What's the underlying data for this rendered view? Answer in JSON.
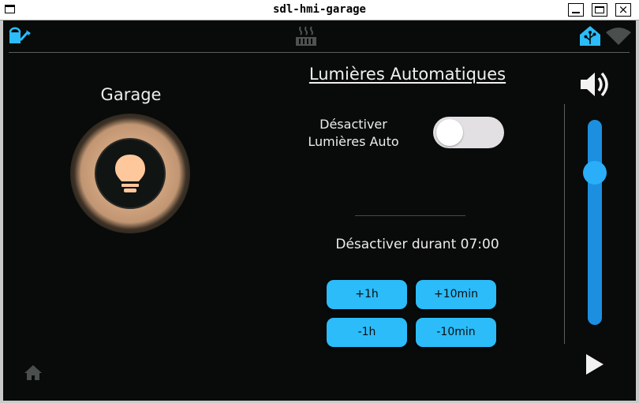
{
  "window": {
    "title": "sdl-hmi-garage"
  },
  "status_bar": {
    "left_icon": "watering-can-icon",
    "center_icon": "heater-icon",
    "right_icons": [
      "home-assistant-icon",
      "wifi-icon"
    ]
  },
  "left_panel": {
    "title": "Garage",
    "lamp_icon": "lightbulb-icon",
    "lamp_state": "on",
    "home_icon": "home-icon"
  },
  "center_panel": {
    "title": "Lumières Automatiques",
    "toggle_label_line1": "Désactiver",
    "toggle_label_line2": "Lumières Auto",
    "toggle_state": "off",
    "delay_text": "Désactiver durant 07:00",
    "buttons": {
      "plus_1h": "+1h",
      "plus_10min": "+10min",
      "minus_1h": "-1h",
      "minus_10min": "-10min"
    }
  },
  "right_panel": {
    "volume_icon": "speaker-icon",
    "volume_level": 0.8,
    "play_icon": "play-icon"
  },
  "colors": {
    "background": "#080b0a",
    "accent": "#2bbcf9",
    "slider": "#1d8fe0",
    "lamp_glow": "#ffc79c",
    "text": "#ececec"
  }
}
